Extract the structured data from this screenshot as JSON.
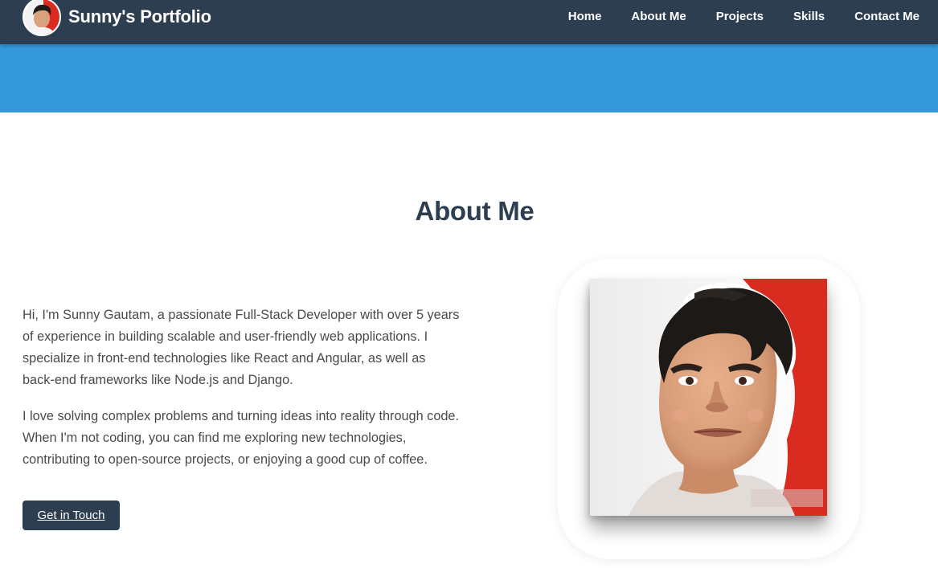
{
  "brand": {
    "title": "Sunny's Portfolio",
    "avatar_icon": "profile-avatar-icon"
  },
  "nav": {
    "items": [
      {
        "label": "Home"
      },
      {
        "label": "About Me"
      },
      {
        "label": "Projects"
      },
      {
        "label": "Skills"
      },
      {
        "label": "Contact Me"
      }
    ]
  },
  "about": {
    "title": "About Me",
    "paragraphs": [
      "Hi, I'm Sunny Gautam, a passionate Full-Stack Developer with over 5 years of experience in building scalable and user-friendly web applications. I specialize in front-end technologies like React and Angular, as well as back-end frameworks like Node.js and Django.",
      "I love solving complex problems and turning ideas into reality through code. When I'm not coding, you can find me exploring new technologies, contributing to open-source projects, or enjoying a good cup of coffee."
    ],
    "cta_label": "Get in Touch",
    "photo_icon": "profile-portrait-icon"
  },
  "colors": {
    "navbar": "#2c3e50",
    "hero": "#3498db",
    "title": "#2c3e50",
    "button": "#2c3e50",
    "portrait_red": "#d92b20"
  }
}
